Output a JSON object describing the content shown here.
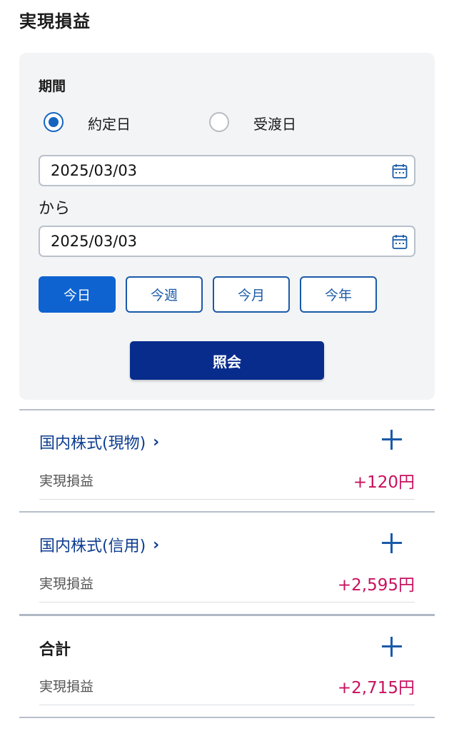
{
  "page": {
    "title": "実現損益"
  },
  "filter": {
    "period_label": "期間",
    "radio_options": [
      {
        "label": "約定日",
        "checked": true
      },
      {
        "label": "受渡日",
        "checked": false
      }
    ],
    "from_date": "2025/03/03",
    "separator": "から",
    "to_date": "2025/03/03",
    "quick_buttons": [
      {
        "label": "今日",
        "active": true
      },
      {
        "label": "今週",
        "active": false
      },
      {
        "label": "今月",
        "active": false
      },
      {
        "label": "今年",
        "active": false
      }
    ],
    "query_label": "照会"
  },
  "sections": [
    {
      "title": "国内株式(現物)",
      "chevron": "›",
      "metric_label": "実現損益",
      "value": "+120円"
    },
    {
      "title": "国内株式(信用)",
      "chevron": "›",
      "metric_label": "実現損益",
      "value": "+2,595円"
    },
    {
      "title": "合計",
      "metric_label": "実現損益",
      "value": "+2,715円"
    }
  ],
  "colors": {
    "accent": "#0e63d0",
    "primary_button": "#082c8c",
    "link": "#0d3d8f",
    "profit": "#c8115e"
  },
  "icons": {
    "date_picker": "calendar-icon",
    "expand": "plus-icon",
    "navigate": "chevron-right-icon"
  }
}
